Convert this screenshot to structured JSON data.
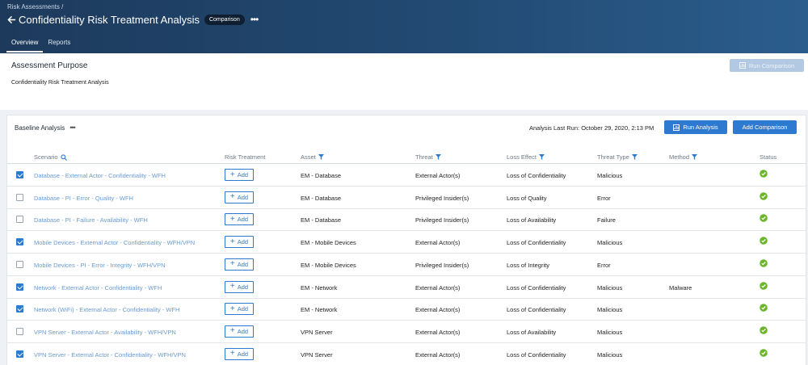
{
  "header": {
    "breadcrumb": "Risk Assessments /",
    "title": "Confidentiality Risk Treatment Analysis",
    "badge": "Comparison",
    "tabs": [
      {
        "label": "Overview",
        "active": true
      },
      {
        "label": "Reports",
        "active": false
      }
    ]
  },
  "purpose": {
    "title": "Assessment Purpose",
    "text": "Confidentiality Risk Treatment Analysis",
    "run_comparison_label": "Run Comparison"
  },
  "baseline": {
    "title": "Baseline Analysis",
    "last_run": "Analysis Last Run: October 29, 2020, 2:13 PM",
    "run_analysis_label": "Run Analysis",
    "add_comparison_label": "Add Comparison",
    "columns": {
      "scenario": "Scenario",
      "risk_treatment": "Risk Treatment",
      "asset": "Asset",
      "threat": "Threat",
      "loss_effect": "Loss Effect",
      "threat_type": "Threat Type",
      "method": "Method",
      "status": "Status"
    },
    "add_label": "Add",
    "rows": [
      {
        "checked": true,
        "scenario": "Database - External Actor - Confidentiality - WFH",
        "asset": "EM - Database",
        "threat": "External Actor(s)",
        "loss_effect": "Loss of Confidentiality",
        "threat_type": "Malicious",
        "method": ""
      },
      {
        "checked": false,
        "scenario": "Database - PI - Error - Quality - WFH",
        "asset": "EM - Database",
        "threat": "Privileged Insider(s)",
        "loss_effect": "Loss of Quality",
        "threat_type": "Error",
        "method": ""
      },
      {
        "checked": false,
        "scenario": "Database - PI - Failure - Availability - WFH",
        "asset": "EM - Database",
        "threat": "Privileged Insider(s)",
        "loss_effect": "Loss of Availability",
        "threat_type": "Failure",
        "method": ""
      },
      {
        "checked": true,
        "scenario": "Mobile Devices - External Actor - Confidentiality - WFH/VPN",
        "asset": "EM - Mobile Devices",
        "threat": "External Actor(s)",
        "loss_effect": "Loss of Confidentiality",
        "threat_type": "Malicious",
        "method": ""
      },
      {
        "checked": false,
        "scenario": "Mobile Devices - PI - Error - Integrity - WFH/VPN",
        "asset": "EM - Mobile Devices",
        "threat": "Privileged Insider(s)",
        "loss_effect": "Loss of Integrity",
        "threat_type": "Error",
        "method": ""
      },
      {
        "checked": true,
        "scenario": "Network - External Actor - Confidentiality - WFH",
        "asset": "EM - Network",
        "threat": "External Actor(s)",
        "loss_effect": "Loss of Confidentiality",
        "threat_type": "Malicious",
        "method": "Malware"
      },
      {
        "checked": true,
        "scenario": "Network (WiFi) - External Actor - Confidentiality - WFH",
        "asset": "EM - Network",
        "threat": "External Actor(s)",
        "loss_effect": "Loss of Confidentiality",
        "threat_type": "Malicious",
        "method": ""
      },
      {
        "checked": false,
        "scenario": "VPN Server - External Actor - Availability - WFH/VPN",
        "asset": "VPN Server",
        "threat": "External Actor(s)",
        "loss_effect": "Loss of Availability",
        "threat_type": "Malicious",
        "method": ""
      },
      {
        "checked": true,
        "scenario": "VPN Server - External Actor - Confidentiality - WFH/VPN",
        "asset": "VPN Server",
        "threat": "External Actor(s)",
        "loss_effect": "Loss of Confidentiality",
        "threat_type": "Malicious",
        "method": ""
      }
    ]
  },
  "colors": {
    "accent": "#2f7ad1",
    "scenario_link": "#6b9bd0",
    "status_ok": "#6bb52a"
  }
}
